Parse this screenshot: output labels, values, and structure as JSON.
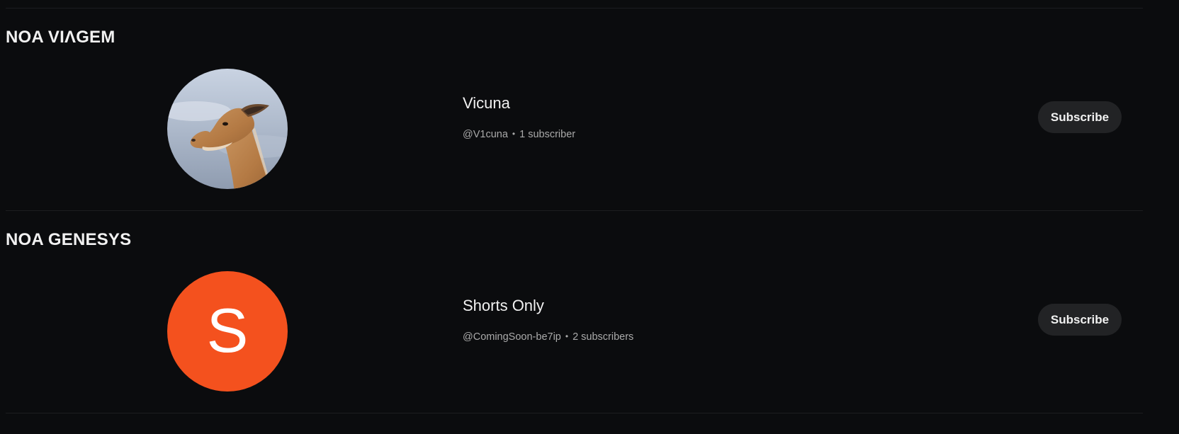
{
  "sections": [
    {
      "title": "NOA VIΛGEM",
      "channel": {
        "name": "Vicuna",
        "handle": "@V1cuna",
        "separator": "•",
        "subscribers": "1 subscriber",
        "avatar": {
          "kind": "photo",
          "subject": "vicuna-head"
        },
        "subscribe_label": "Subscribe"
      }
    },
    {
      "title": "NOA GENESYS",
      "channel": {
        "name": "Shorts Only",
        "handle": "@ComingSoon-be7ip",
        "separator": "•",
        "subscribers": "2 subscribers",
        "avatar": {
          "kind": "letter",
          "letter": "S",
          "color": "#f4511e"
        },
        "subscribe_label": "Subscribe"
      }
    }
  ],
  "colors": {
    "background": "#0b0c0e",
    "button_bg": "#222325",
    "meta_text": "#aaaaaa",
    "divider": "#1c1d20"
  }
}
